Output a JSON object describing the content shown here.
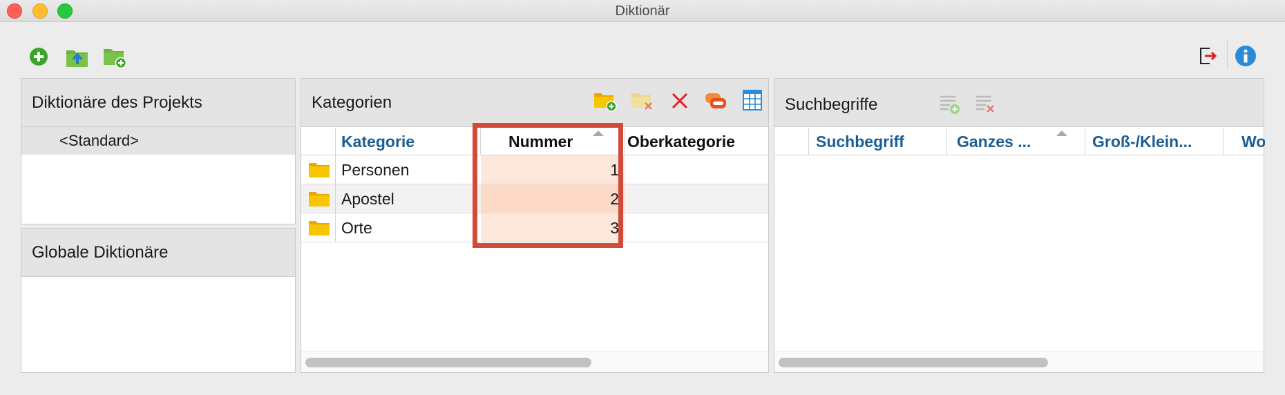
{
  "window": {
    "title": "Diktionär"
  },
  "colors": {
    "accent": "#1b5e94",
    "highlight_border": "#d24b3a",
    "highlight_fill": "#fde6da",
    "folder": "#f7c600"
  },
  "toolbar": {
    "left_icons": [
      "add-circle-icon",
      "folder-export-icon",
      "folder-add-icon"
    ],
    "right_icons": [
      "exit-icon",
      "info-icon"
    ]
  },
  "projects_panel": {
    "title": "Diktionäre des Projekts",
    "items": [
      "<Standard>"
    ]
  },
  "global_panel": {
    "title": "Globale Diktionäre"
  },
  "categories": {
    "title": "Kategorien",
    "tool_icons": [
      "folder-add-icon",
      "folder-remove-icon",
      "delete-x-icon",
      "link-icon",
      "table-icon"
    ],
    "columns": [
      "Kategorie",
      "Nummer",
      "Oberkategorie"
    ],
    "rows": [
      {
        "name": "Personen",
        "number": "1",
        "parent": ""
      },
      {
        "name": "Apostel",
        "number": "2",
        "parent": ""
      },
      {
        "name": "Orte",
        "number": "3",
        "parent": ""
      }
    ]
  },
  "terms": {
    "title": "Suchbegriffe",
    "tool_icons": [
      "list-add-icon",
      "list-remove-icon"
    ],
    "columns": [
      "Suchbegriff",
      "Ganzes ...",
      "Groß-/Klein...",
      "Wo"
    ]
  }
}
